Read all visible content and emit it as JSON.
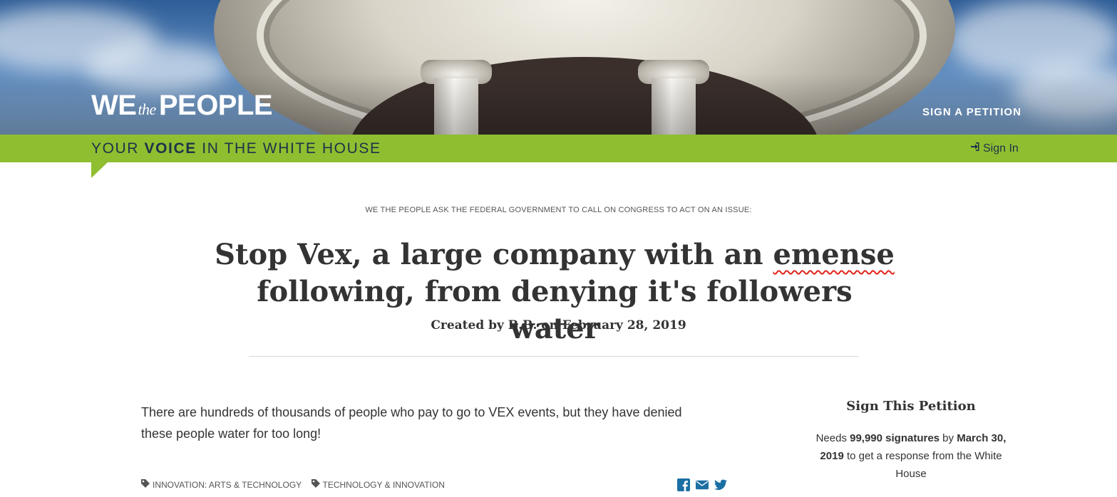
{
  "header": {
    "logo": {
      "we": "WE",
      "the": "the",
      "people": "PEOPLE"
    },
    "nav_sign_petition": "SIGN A PETITION",
    "tagline": {
      "pre": "YOUR ",
      "bold": "VOICE",
      "post": " IN THE WHITE HOUSE"
    },
    "signin": {
      "icon": "sign-in-icon",
      "label": "Sign In"
    }
  },
  "petition": {
    "ask": "WE THE PEOPLE ASK THE FEDERAL GOVERNMENT TO CALL ON CONGRESS TO ACT ON AN ISSUE:",
    "title_part1": "Stop Vex, a large company with an ",
    "title_misspelled": "emense",
    "title_part2": " following, from denying it's followers water",
    "created": "Created by B.B. on February 28, 2019",
    "body": "There are hundreds of thousands of people who pay to go to VEX events, but they have denied these people water for too long!",
    "tags": [
      {
        "icon": "tag-icon",
        "label": "INNOVATION: ARTS & TECHNOLOGY"
      },
      {
        "icon": "tag-icon",
        "label": "TECHNOLOGY & INNOVATION"
      }
    ],
    "share": [
      {
        "icon": "facebook-icon"
      },
      {
        "icon": "email-icon"
      },
      {
        "icon": "twitter-icon"
      }
    ]
  },
  "sidebar": {
    "title": "Sign This Petition",
    "needs_pre": "Needs ",
    "signatures": "99,990 signatures",
    "by": " by ",
    "deadline": "March 30, 2019",
    "needs_post": " to get a response from the White House"
  },
  "colors": {
    "green": "#8fbe31",
    "navy": "#1d3349",
    "share_blue": "#1a6fa3",
    "spellcheck_red": "#e2231a"
  }
}
